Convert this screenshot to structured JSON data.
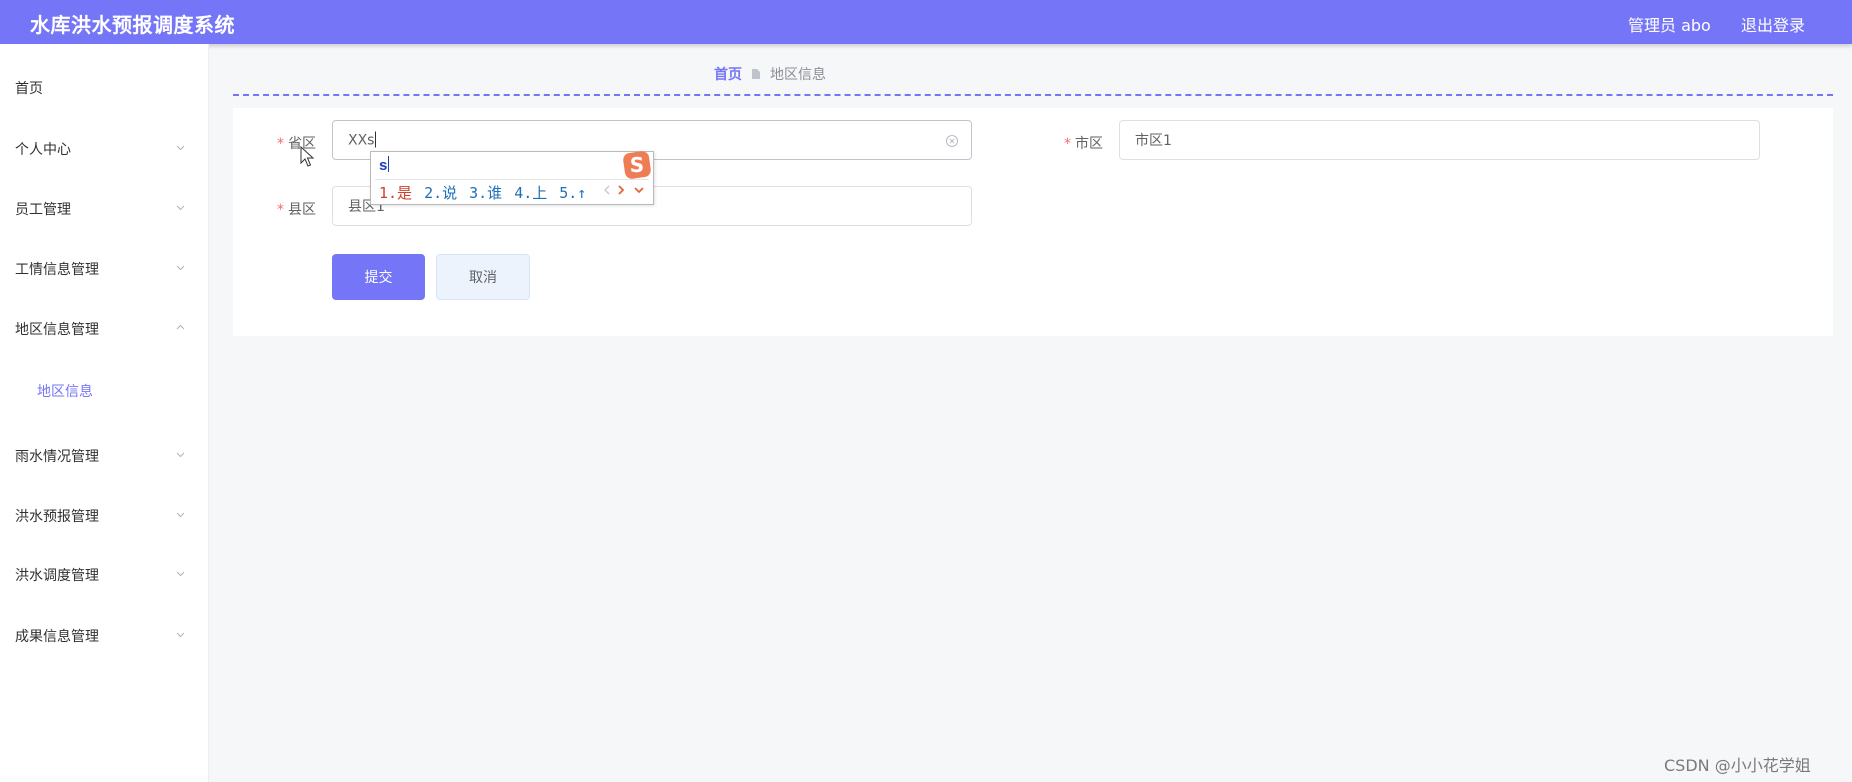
{
  "header": {
    "title": "水库洪水预报调度系统",
    "user": "管理员 abo",
    "logout": "退出登录",
    "accent": "#7575f7"
  },
  "sidebar": {
    "items": [
      {
        "label": "首页"
      },
      {
        "label": "个人中心"
      },
      {
        "label": "员工管理"
      },
      {
        "label": "工情信息管理"
      },
      {
        "label": "地区信息管理",
        "expanded": true,
        "children": [
          {
            "label": "地区信息",
            "active": true
          }
        ]
      },
      {
        "label": "雨水情况管理"
      },
      {
        "label": "洪水预报管理"
      },
      {
        "label": "洪水调度管理"
      },
      {
        "label": "成果信息管理"
      }
    ]
  },
  "breadcrumb": {
    "home": "首页",
    "current": "地区信息"
  },
  "form": {
    "province": {
      "label": "省区",
      "value": "XXs"
    },
    "city": {
      "label": "市区",
      "value": "市区1"
    },
    "county": {
      "label": "县区",
      "value": "县区1"
    },
    "submit": "提交",
    "cancel": "取消"
  },
  "ime": {
    "composition": "s",
    "candidates": [
      "1.是",
      "2.说",
      "3.谁",
      "4.上",
      "5.↑"
    ],
    "logo_glyph": "S"
  },
  "watermark": "CSDN @小小花学姐"
}
